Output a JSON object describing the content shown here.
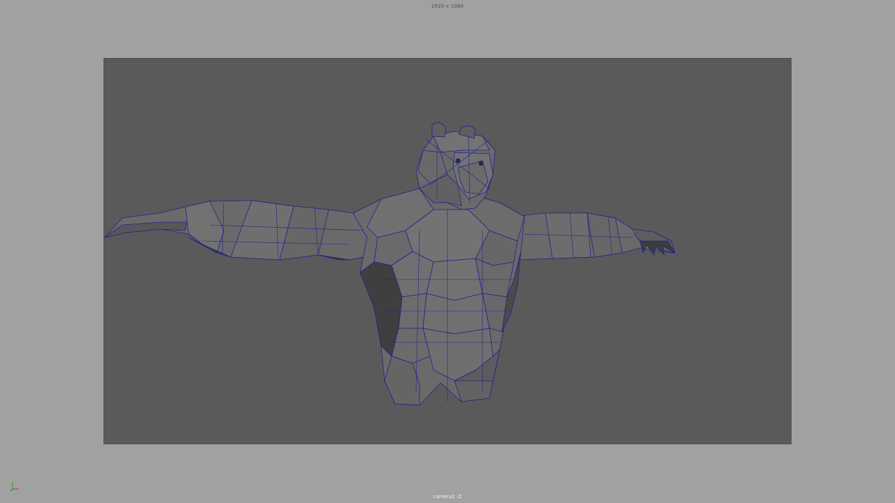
{
  "viewport": {
    "resolution_label": "1920 x 1080",
    "camera_label": "camera1 -Z"
  },
  "colors": {
    "background": "#a1a1a1",
    "gate_background": "#5a5a5a",
    "wireframe": "#22208e",
    "surface": "#6b6b6b",
    "surface_dark": "#4a4a4a"
  },
  "icons": {
    "axis": "xyz-axis-icon"
  }
}
